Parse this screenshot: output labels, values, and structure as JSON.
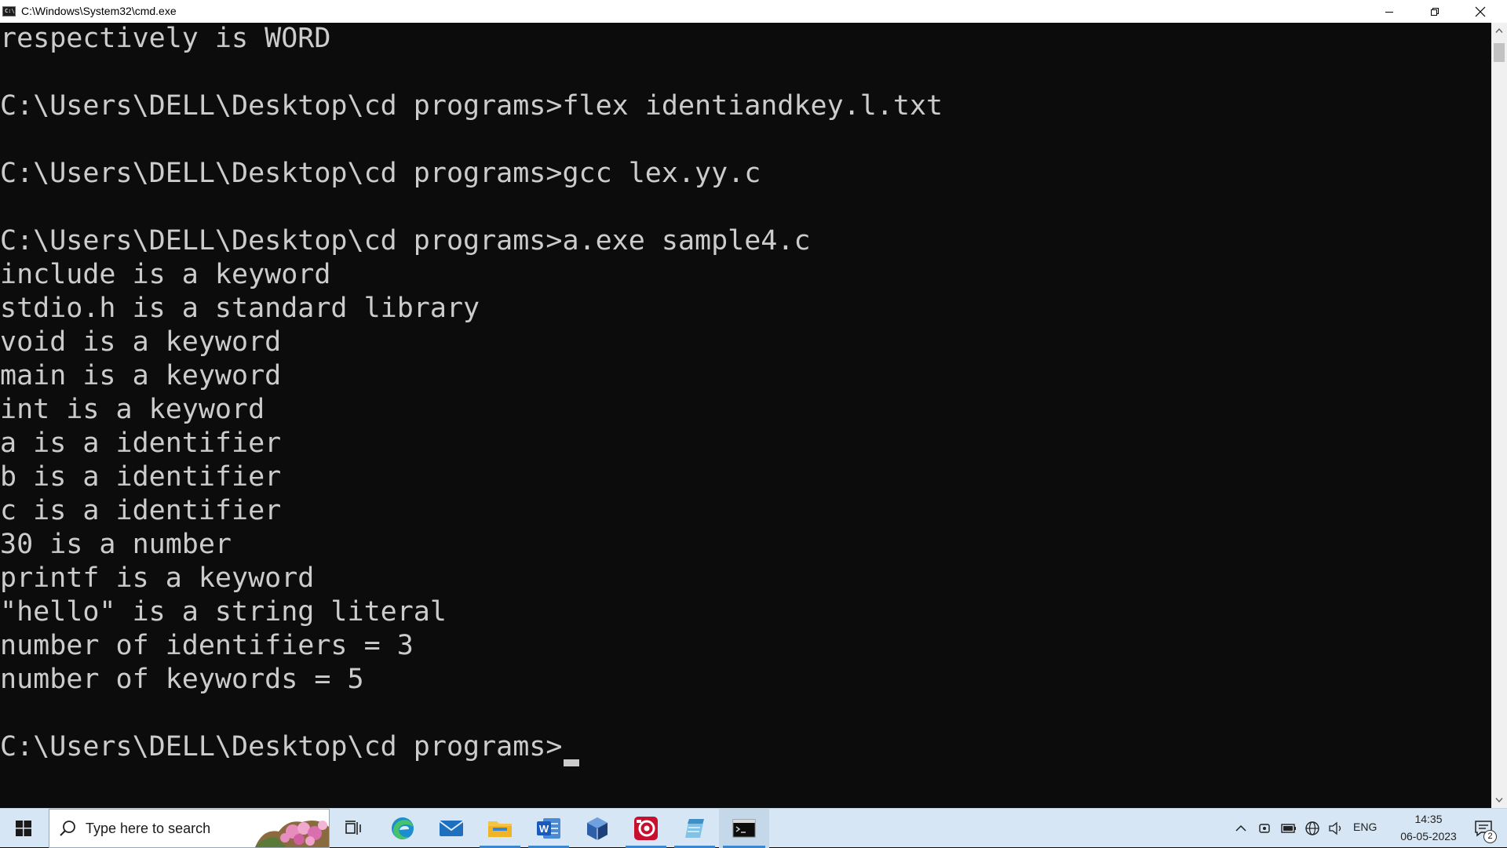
{
  "window": {
    "title": "C:\\Windows\\System32\\cmd.exe",
    "icon_text": "C:\\"
  },
  "console": {
    "lines": [
      "respectively is WORD",
      "",
      "C:\\Users\\DELL\\Desktop\\cd programs>flex identiandkey.l.txt",
      "",
      "C:\\Users\\DELL\\Desktop\\cd programs>gcc lex.yy.c",
      "",
      "C:\\Users\\DELL\\Desktop\\cd programs>a.exe sample4.c",
      "include is a keyword",
      "stdio.h is a standard library",
      "void is a keyword",
      "main is a keyword",
      "int is a keyword",
      "a is a identifier",
      "b is a identifier",
      "c is a identifier",
      "30 is a number",
      "printf is a keyword",
      "\"hello\" is a string literal",
      "number of identifiers = 3",
      "number of keywords = 5",
      "",
      "C:\\Users\\DELL\\Desktop\\cd programs>"
    ],
    "text_color": "#cccccc",
    "background": "#0c0c0c"
  },
  "taskbar": {
    "search_placeholder": "Type here to search",
    "apps": [
      {
        "name": "task-view",
        "icon": "task-view-icon",
        "running": false
      },
      {
        "name": "edge",
        "icon": "edge-icon",
        "running": false
      },
      {
        "name": "mail",
        "icon": "mail-icon",
        "running": false
      },
      {
        "name": "file-explorer",
        "icon": "folder-icon",
        "running": true
      },
      {
        "name": "word",
        "icon": "word-icon",
        "running": true
      },
      {
        "name": "virtualbox",
        "icon": "virtualbox-icon",
        "running": false
      },
      {
        "name": "screen-recorder",
        "icon": "recorder-icon",
        "running": true
      },
      {
        "name": "notepad",
        "icon": "notepad-icon",
        "running": true
      },
      {
        "name": "cmd",
        "icon": "terminal-icon",
        "running": true
      }
    ],
    "tray": {
      "language": "ENG",
      "time": "14:35",
      "date": "06-05-2023",
      "notification_count": "2"
    },
    "accent": "#3a86cf"
  }
}
